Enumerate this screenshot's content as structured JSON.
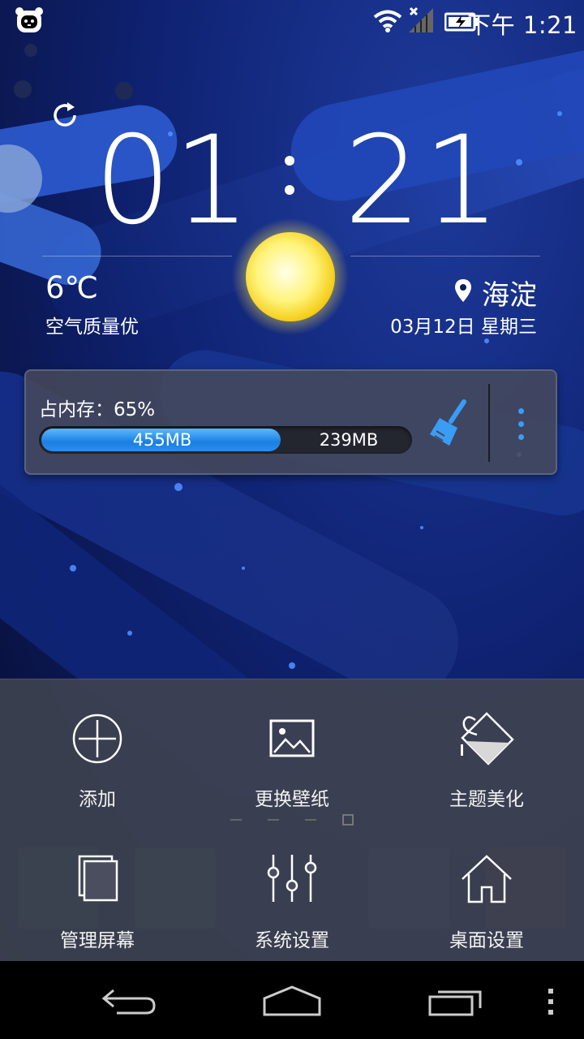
{
  "status_bar": {
    "time": "下午 1:21",
    "icons": [
      "panda-app-icon",
      "wifi-icon",
      "signal-off-icon",
      "battery-charging-icon"
    ]
  },
  "clock": {
    "hours": "01",
    "minutes": "21"
  },
  "weather": {
    "temperature": "6℃",
    "air_quality": "空气质量优",
    "icon": "sun-icon",
    "refresh_icon": "refresh-icon"
  },
  "location": {
    "name": "海淀",
    "date": "03月12日  星期三"
  },
  "memory": {
    "label": "占内存：65%",
    "percent": 65,
    "used": "455MB",
    "free": "239MB",
    "clean_icon": "broom-icon",
    "menu_icon": "more-vertical-icon"
  },
  "menu": {
    "items": [
      {
        "label": "添加",
        "icon": "add-circle-icon"
      },
      {
        "label": "更换壁纸",
        "icon": "wallpaper-icon"
      },
      {
        "label": "主题美化",
        "icon": "paint-bucket-icon"
      },
      {
        "label": "管理屏幕",
        "icon": "screens-icon"
      },
      {
        "label": "系统设置",
        "icon": "sliders-icon"
      },
      {
        "label": "桌面设置",
        "icon": "home-icon"
      }
    ]
  },
  "navbar": {
    "back": "back-icon",
    "home": "home-nav-icon",
    "recents": "recents-icon",
    "overflow": "overflow-icon"
  },
  "colors": {
    "accent": "#3a9cf5",
    "bar_fill": "#1a7fe0",
    "panel": "#3e4250"
  }
}
